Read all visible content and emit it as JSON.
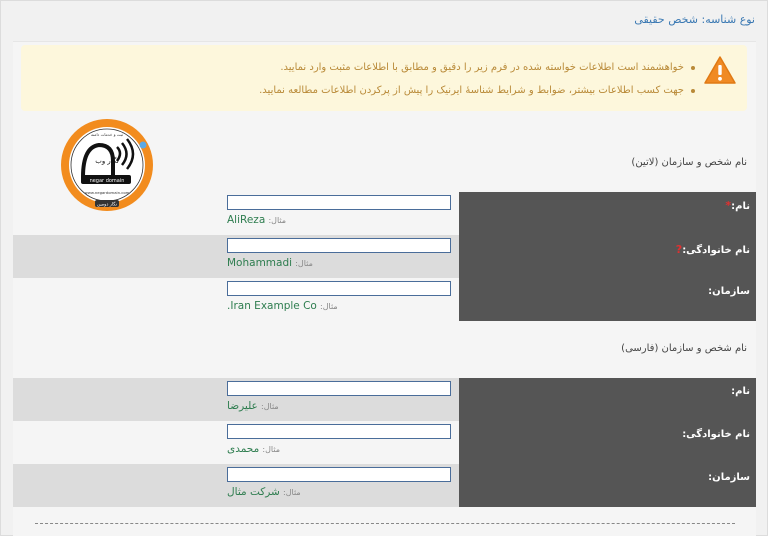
{
  "header": {
    "title": "نوع شناسه: شخص حقیقی"
  },
  "notice": {
    "icon": "warning-icon",
    "color": "#b98a38",
    "items": [
      "خواهشمند است اطلاعات خواسته شده در فرم زیر را دقیق و مطابق با اطلاعات مثبت وارد نمایید.",
      "جهت کسب اطلاعات بیشتر، ضوابط و شرایط شناسهٔ ایرنیک را پیش از پرکردن اطلاعات مطالعه نمایید."
    ]
  },
  "logo": {
    "top_text": "ثبت و خدمات دامنه",
    "main": "نگار وب",
    "sub": "negar domain",
    "url": "www.negardomain.com",
    "bottom": "نگار دومین"
  },
  "latin": {
    "title": "نام شخص و سازمان (لاتین)",
    "rows": [
      {
        "label": "نام:",
        "required": "*",
        "example_label": "مثال:",
        "example_value": "AliReza"
      },
      {
        "label": "نام خانوادگی:",
        "required": "?",
        "example_label": "مثال:",
        "example_value": "Mohammadi"
      },
      {
        "label": "سازمان:",
        "required": "",
        "example_label": "مثال:",
        "example_value": "Iran Example Co."
      }
    ]
  },
  "farsi": {
    "title": "نام شخص و سازمان (فارسی)",
    "rows": [
      {
        "label": "نام:",
        "example_label": "مثال:",
        "example_value": "علیرضا"
      },
      {
        "label": "نام خانوادگی:",
        "example_label": "مثال:",
        "example_value": "محمدی"
      },
      {
        "label": "سازمان:",
        "example_label": "مثال:",
        "example_value": "شرکت مثال"
      }
    ]
  }
}
